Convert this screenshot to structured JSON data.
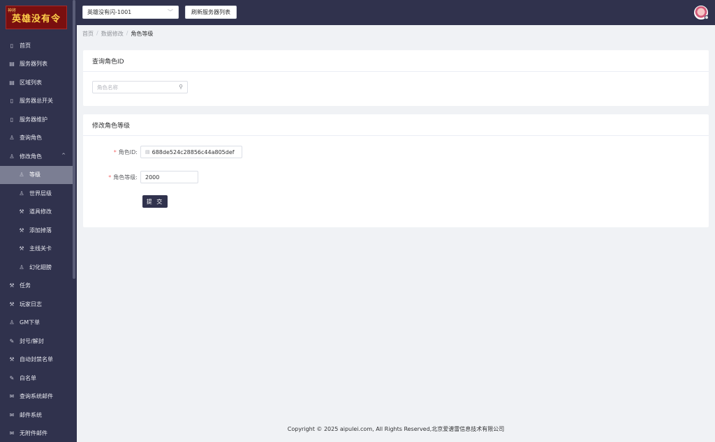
{
  "logo": {
    "small_text": "神将",
    "title": "英雄没有令"
  },
  "sidebar": {
    "items": [
      {
        "label": "首页",
        "icon": "phone-icon"
      },
      {
        "label": "服务器列表",
        "icon": "list-icon"
      },
      {
        "label": "区域列表",
        "icon": "list-icon"
      },
      {
        "label": "服务器总开关",
        "icon": "phone-icon"
      },
      {
        "label": "服务器维护",
        "icon": "phone-icon"
      },
      {
        "label": "查询角色",
        "icon": "user-icon"
      },
      {
        "label": "修改角色",
        "icon": "user-icon",
        "caret": "^"
      },
      {
        "label": "等级",
        "icon": "user-icon",
        "sub": true,
        "active": true
      },
      {
        "label": "世界层级",
        "icon": "user-icon",
        "sub": true
      },
      {
        "label": "道具修改",
        "icon": "wrench-icon",
        "sub": true
      },
      {
        "label": "添加掉落",
        "icon": "wrench-icon",
        "sub": true
      },
      {
        "label": "主线关卡",
        "icon": "wrench-icon",
        "sub": true
      },
      {
        "label": "幻化翅膀",
        "icon": "user-icon",
        "sub": true
      },
      {
        "label": "任务",
        "icon": "wrench-icon"
      },
      {
        "label": "玩家日志",
        "icon": "wrench-icon"
      },
      {
        "label": "GM下单",
        "icon": "user-icon"
      },
      {
        "label": "封号/解封",
        "icon": "edit-icon"
      },
      {
        "label": "自动封禁名单",
        "icon": "wrench-icon"
      },
      {
        "label": "白名单",
        "icon": "edit-icon"
      },
      {
        "label": "查询系统邮件",
        "icon": "mail-icon"
      },
      {
        "label": "邮件系统",
        "icon": "mail-icon"
      },
      {
        "label": "无附件邮件",
        "icon": "mail-icon"
      }
    ]
  },
  "topbar": {
    "server_select": "英雄没有闪-1001",
    "refresh_label": "刷新服务器列表"
  },
  "breadcrumb": {
    "home": "首页",
    "section": "数据修改",
    "current": "角色等级"
  },
  "query_card": {
    "title": "查询角色ID",
    "search_placeholder": "角色名称"
  },
  "modify_card": {
    "title": "修改角色等级",
    "id_label": "角色ID:",
    "id_value": "688de524c28856c44a805def",
    "level_label": "角色等级:",
    "level_value": "2000",
    "submit_label": "提 交"
  },
  "footer": {
    "copyright": "Copyright © 2025 aipulei.com, All Rights Reserved,北京爱谱雷信息技术有限公司"
  },
  "colors": {
    "sidebar_bg": "#30324d",
    "active_item": "#7b7e93",
    "primary_button": "#30324d",
    "required": "#f56c6c"
  }
}
